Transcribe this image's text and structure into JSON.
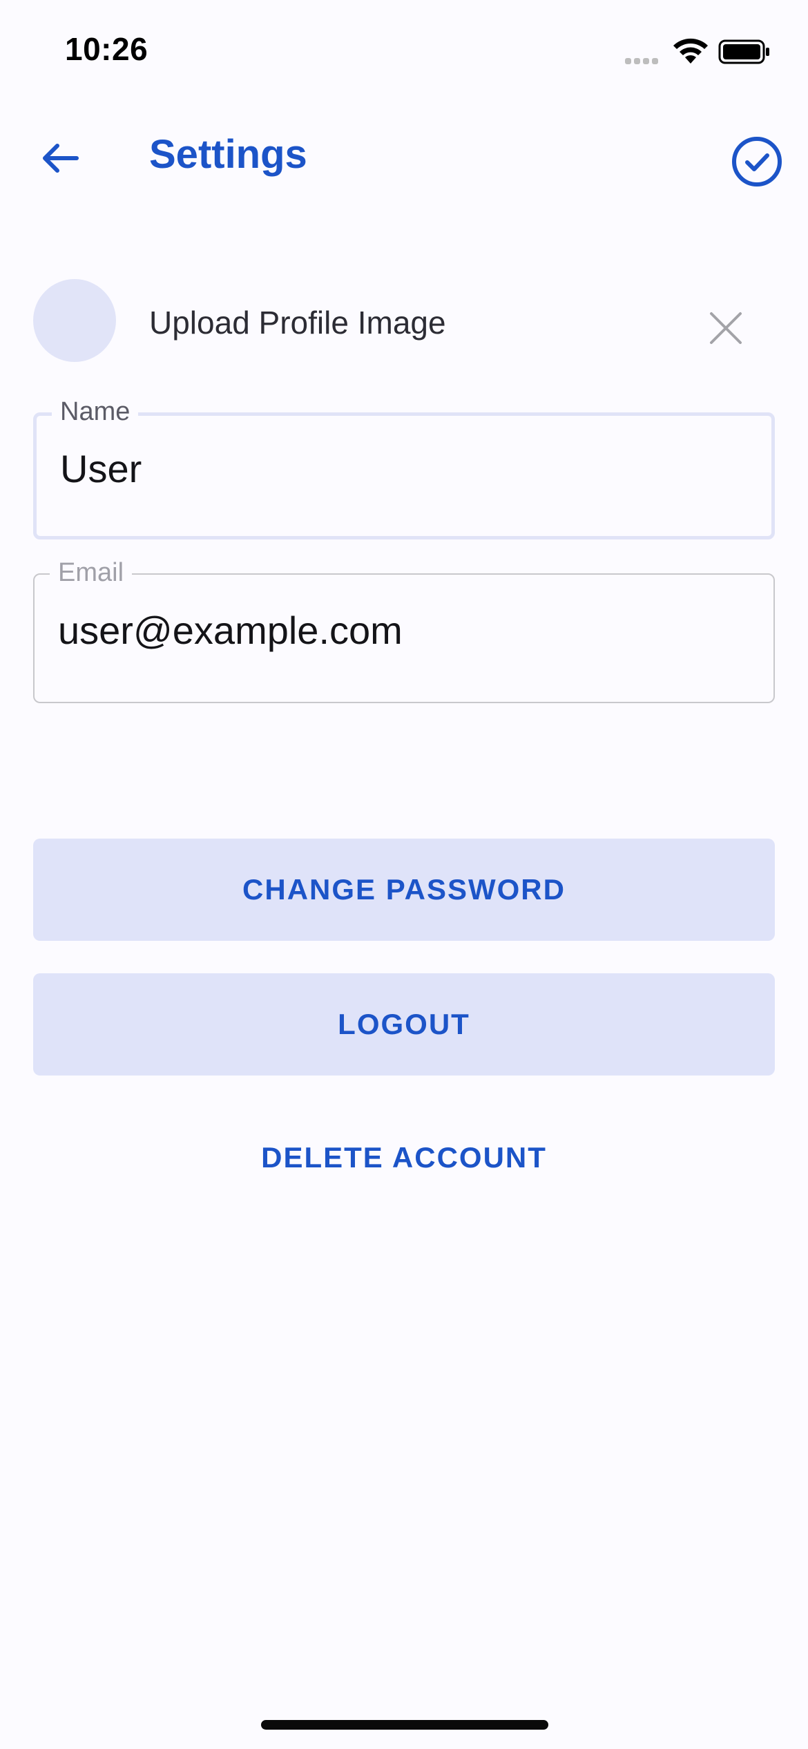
{
  "status_bar": {
    "time": "10:26",
    "icons": [
      "signal-icon",
      "wifi-icon",
      "battery-icon"
    ]
  },
  "header": {
    "title": "Settings",
    "back_icon": "arrow-left-icon",
    "confirm_icon": "check-circle-icon"
  },
  "profile": {
    "upload_label": "Upload Profile Image",
    "close_icon": "close-icon"
  },
  "form": {
    "name": {
      "label": "Name",
      "value": "User"
    },
    "email": {
      "label": "Email",
      "value": "user@example.com"
    }
  },
  "actions": {
    "change_password": "CHANGE PASSWORD",
    "logout": "LOGOUT",
    "delete_account": "DELETE ACCOUNT"
  },
  "colors": {
    "accent": "#1C54C8",
    "button_bg": "#DFE3F9",
    "avatar_bg": "#E1E4F8",
    "background": "#FCFBFF"
  }
}
